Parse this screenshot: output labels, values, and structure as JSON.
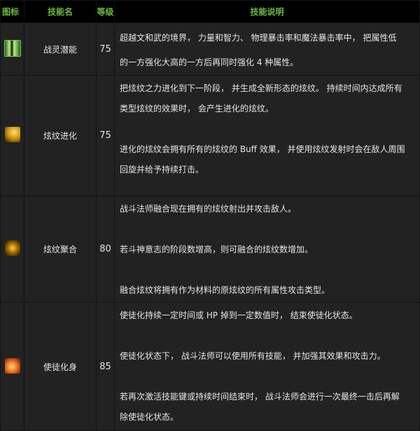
{
  "header": {
    "icon": "图标",
    "name": "技能名",
    "level": "等级",
    "desc": "技能说明"
  },
  "rows": [
    {
      "icon": "spirit-silhouette-icon",
      "name": "战灵潜能",
      "level": "75",
      "lines": [
        "超越文和武的境界， 力量和智力、 物理暴击率和魔法暴击率中， 把属性低",
        "的一方强化大高的一方后再同时强化 4 种属性。"
      ]
    },
    {
      "icon": "pattern-evolution-icon",
      "name": "炫纹进化",
      "level": "75",
      "lines": [
        "把炫纹之力进化到下一阶段， 并生成全新形态的炫纹。 持续时间内达成所有",
        "类型炫纹的效果时， 会产生进化的炫纹。",
        "",
        "进化的炫纹会拥有所有的炫纹的 Buff 效果， 并使用炫纹发射时会在敌人周围",
        "回旋并给予持续打击。"
      ]
    },
    {
      "icon": "pattern-fusion-icon",
      "name": "炫纹聚合",
      "level": "80",
      "lines": [
        "战斗法师融合现在拥有的炫纹射出并攻击敌人。",
        "",
        "若斗神意志的阶段数增高，则可融合的炫纹数增加。",
        "",
        "融合炫纹将拥有作为材料的原炫纹的所有属性攻击类型。"
      ]
    },
    {
      "icon": "apostle-form-icon",
      "name": "使徒化身",
      "level": "85",
      "lines": [
        "使徒化持续一定时间或 HP 掉到一定数值时， 结束使徒化状态。",
        "",
        "使徒化状态下， 战斗法师可以使用所有技能， 并加强其效果和攻击力。",
        "",
        "若再次激活技能键或持续时间结束时， 战斗法师会进行一次最终一击后再解",
        "除使徒化状态。"
      ]
    }
  ]
}
